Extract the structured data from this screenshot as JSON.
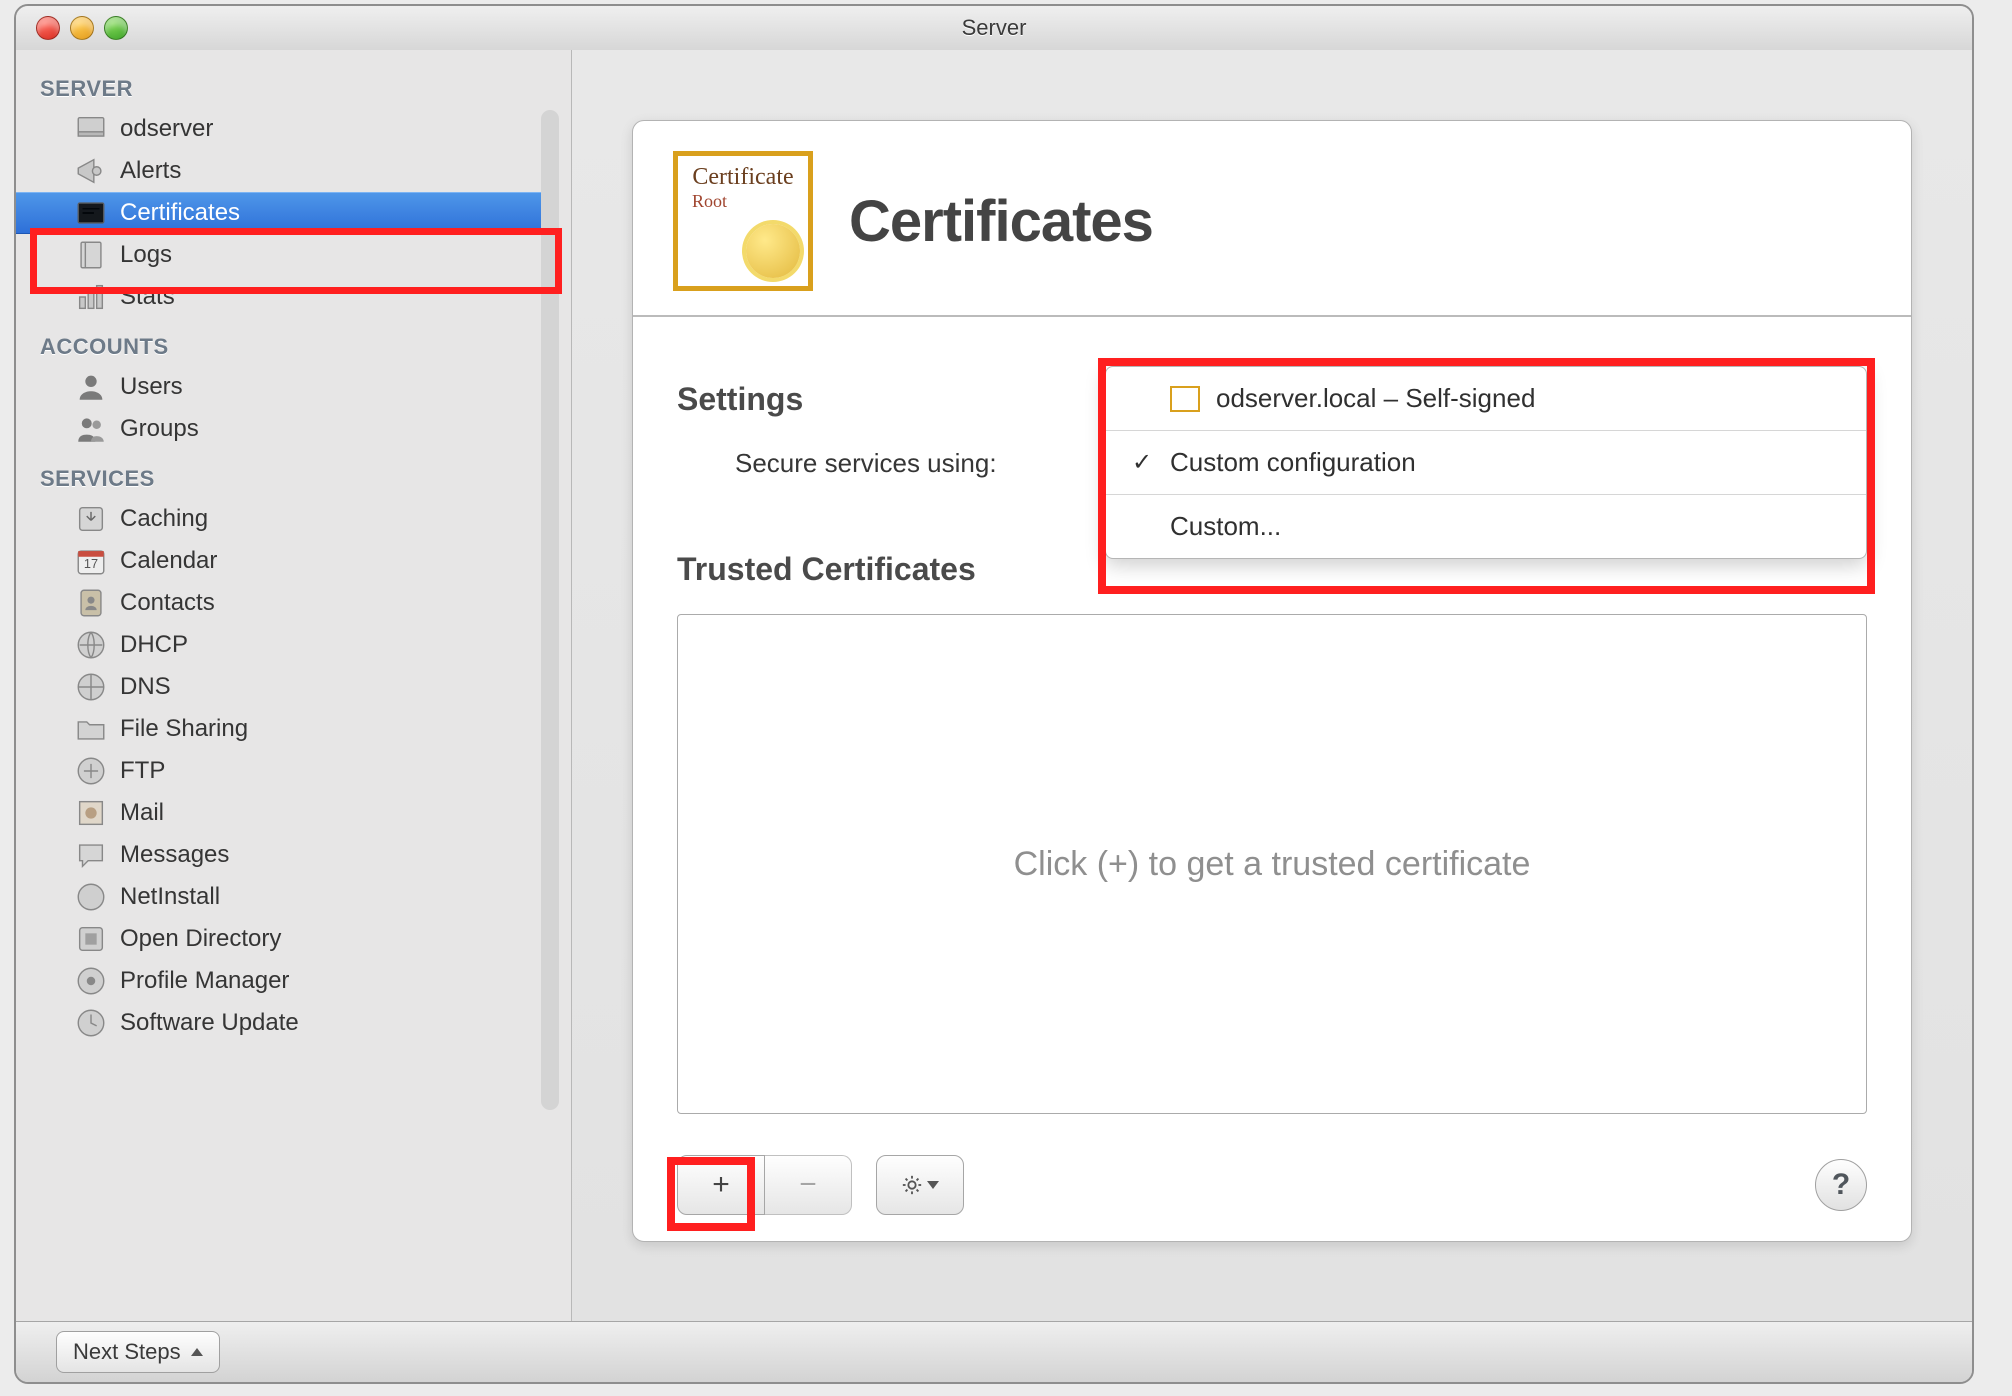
{
  "window": {
    "title": "Server"
  },
  "sidebar": {
    "sections": [
      {
        "label": "SERVER",
        "items": [
          {
            "label": "odserver"
          },
          {
            "label": "Alerts"
          },
          {
            "label": "Certificates",
            "selected": true
          },
          {
            "label": "Logs"
          },
          {
            "label": "Stats"
          }
        ]
      },
      {
        "label": "ACCOUNTS",
        "items": [
          {
            "label": "Users"
          },
          {
            "label": "Groups"
          }
        ]
      },
      {
        "label": "SERVICES",
        "items": [
          {
            "label": "Caching"
          },
          {
            "label": "Calendar"
          },
          {
            "label": "Contacts"
          },
          {
            "label": "DHCP"
          },
          {
            "label": "DNS"
          },
          {
            "label": "File Sharing"
          },
          {
            "label": "FTP"
          },
          {
            "label": "Mail"
          },
          {
            "label": "Messages"
          },
          {
            "label": "NetInstall"
          },
          {
            "label": "Open Directory"
          },
          {
            "label": "Profile Manager"
          },
          {
            "label": "Software Update"
          }
        ]
      }
    ]
  },
  "main": {
    "title": "Certificates",
    "badge": {
      "line1": "Certificate",
      "line2": "Root"
    },
    "settings_label": "Settings",
    "secure_label": "Secure services using:",
    "trusted_label": "Trusted Certificates",
    "placeholder": "Click (+) to get a trusted certificate",
    "dropdown": {
      "options": [
        {
          "label": "odserver.local – Self-signed",
          "cert_icon": true
        },
        {
          "label": "Custom configuration",
          "checked": true
        },
        {
          "label": "Custom..."
        }
      ]
    },
    "actions": {
      "add": "+",
      "remove": "−",
      "help": "?"
    }
  },
  "status_bar": {
    "next_steps": "Next Steps"
  }
}
